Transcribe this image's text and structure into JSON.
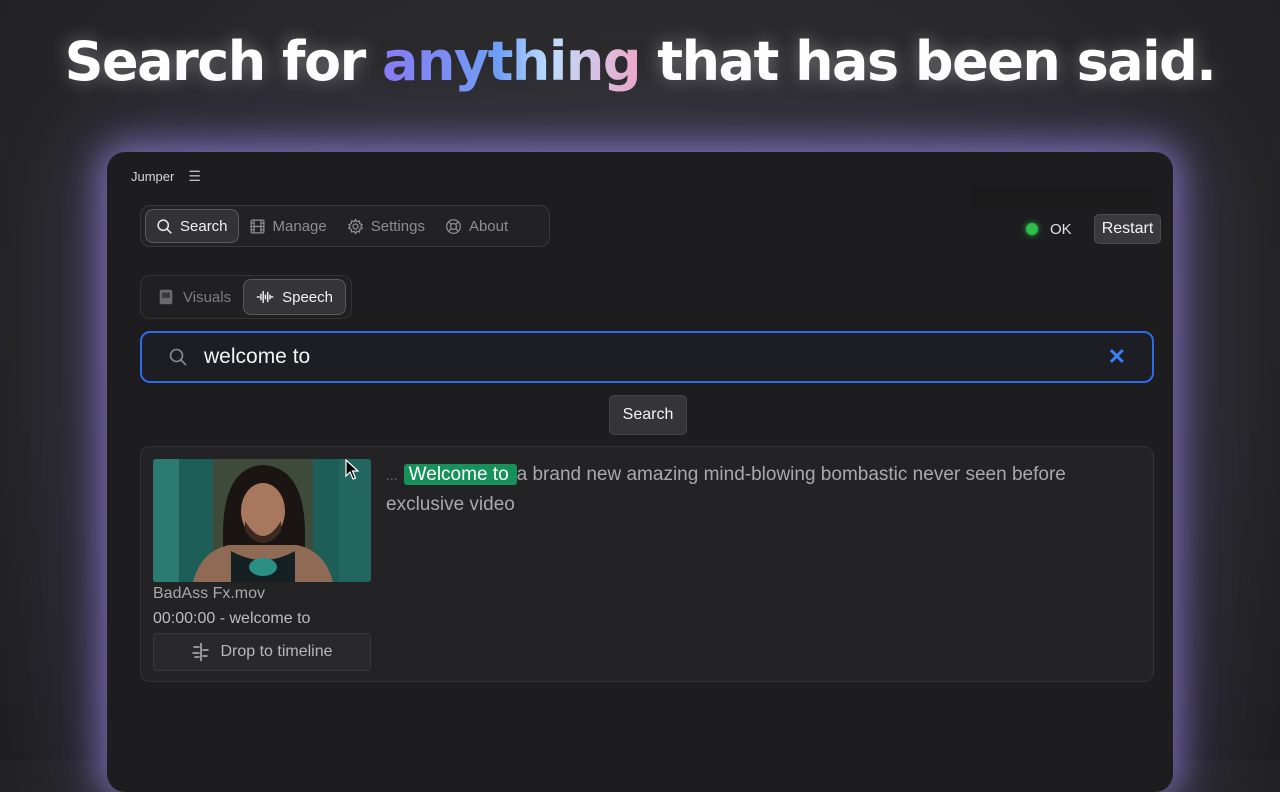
{
  "headline": {
    "before": "Search for ",
    "highlight": "anything",
    "after": " that has been said."
  },
  "app": {
    "name": "Jumper",
    "menu_icon": "hamburger-icon"
  },
  "nav_tabs": [
    {
      "label": "Search",
      "icon": "search-icon",
      "active": true
    },
    {
      "label": "Manage",
      "icon": "film-icon",
      "active": false
    },
    {
      "label": "Settings",
      "icon": "gear-icon",
      "active": false
    },
    {
      "label": "About",
      "icon": "lifebuoy-icon",
      "active": false
    }
  ],
  "status": {
    "label": "OK",
    "color": "#2fbf4a",
    "restart_label": "Restart"
  },
  "mode_tabs": [
    {
      "label": "Visuals",
      "icon": "frame-icon",
      "active": false
    },
    {
      "label": "Speech",
      "icon": "waveform-icon",
      "active": true
    }
  ],
  "search": {
    "value": "welcome to",
    "clear_symbol": "✕",
    "button_label": "Search"
  },
  "result": {
    "file_name": "BadAss Fx.mov",
    "timestamp_line": "00:00:00 - welcome to",
    "drop_label": "Drop to timeline",
    "transcript_prefix": "...",
    "transcript_match": "Welcome to",
    "transcript_rest": "a brand new amazing mind-blowing bombastic never seen before exclusive video"
  },
  "colors": {
    "accent_blue": "#2e6be6",
    "highlight_green": "#17915a",
    "glow": "#aa96ff"
  }
}
